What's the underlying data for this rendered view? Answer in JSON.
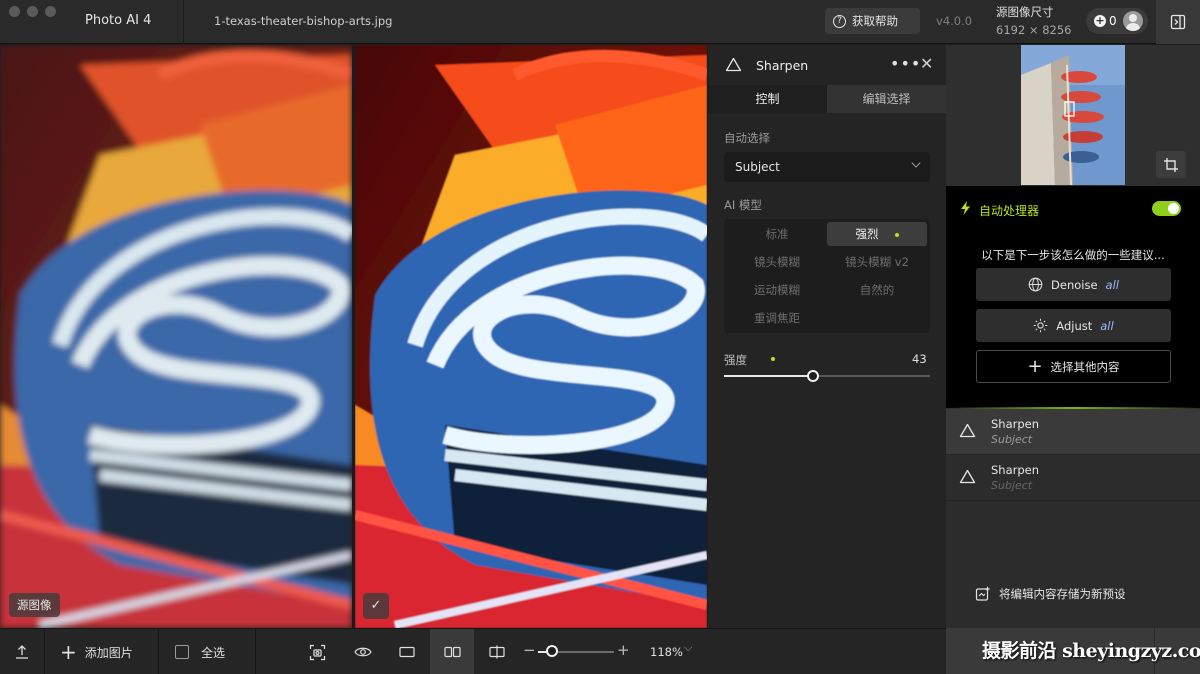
{
  "titlebar": {
    "app_title": "Photo AI  4",
    "file_name": "1-texas-theater-bishop-arts.jpg",
    "help_label": "获取帮助",
    "version": "v4.0.0",
    "source_size_label": "源图像尺寸",
    "source_size_value": "6192 × 8256",
    "credits": "0"
  },
  "preview": {
    "original_badge": "源图像",
    "processed_badge": "✓"
  },
  "bottom_toolbar": {
    "add_image_label": "添加图片",
    "select_all_label": "全选",
    "zoom_value": "118%",
    "zoom_fraction": 0.18
  },
  "tool_panel": {
    "title": "Sharpen",
    "tabs": [
      {
        "label": "控制",
        "active": true
      },
      {
        "label": "编辑选择",
        "active": false
      }
    ],
    "auto_select_label": "自动选择",
    "auto_select_value": "Subject",
    "ai_model_label": "AI 模型",
    "models": [
      {
        "label": "标准",
        "selected": false
      },
      {
        "label": "强烈",
        "selected": true
      },
      {
        "label": "镜头模糊",
        "selected": false
      },
      {
        "label": "镜头模糊 v2",
        "selected": false
      },
      {
        "label": "运动模糊",
        "selected": false
      },
      {
        "label": "自然的",
        "selected": false
      },
      {
        "label": "重调焦距",
        "selected": false
      }
    ],
    "strength_label": "强度",
    "strength_value": "43",
    "strength_fraction": 0.43
  },
  "right_panel": {
    "autopilot_title": "自动处理器",
    "autopilot_enabled": true,
    "hint": "以下是下一步该怎么做的一些建议...",
    "suggestions": [
      {
        "label": "Denoise",
        "scope": "all",
        "icon": "globe-icon"
      },
      {
        "label": "Adjust",
        "scope": "all",
        "icon": "sun-icon"
      }
    ],
    "choose_other_label": "选择其他内容",
    "steps": [
      {
        "name": "Sharpen",
        "target": "Subject",
        "selected": true
      },
      {
        "name": "Sharpen",
        "target": "Subject",
        "selected": false
      }
    ],
    "save_preset_label": "将编辑内容存储为新预设"
  },
  "watermark": "摄影前沿 sheyingzyz.com",
  "colors": {
    "accent_green": "#b5e61d",
    "toggle_green": "#8fcf1c",
    "scope_blue": "#9bb4ff",
    "panel_bg": "#242424",
    "autopilot_bg": "#000000"
  }
}
